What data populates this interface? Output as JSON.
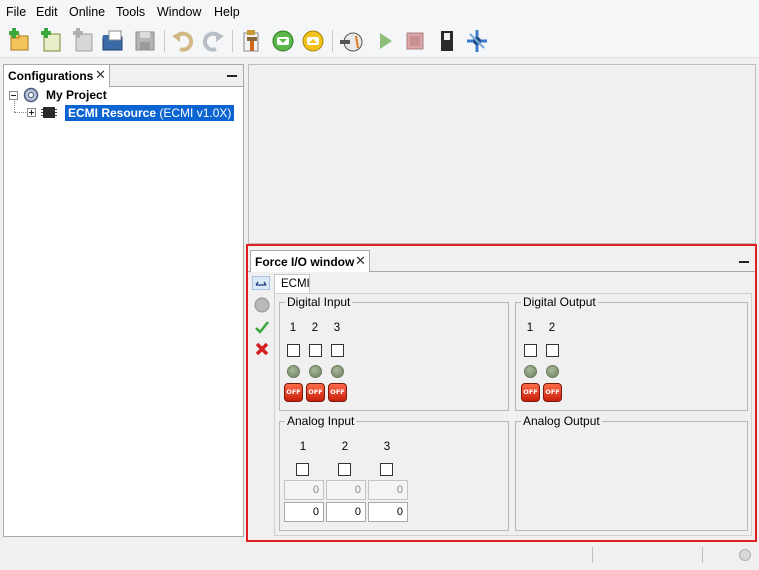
{
  "menu": [
    "File",
    "Edit",
    "Online",
    "Tools",
    "Window",
    "Help"
  ],
  "toolbar": {
    "buttons": [
      "new-project",
      "new-resource",
      "add-item",
      "open",
      "save",
      "undo",
      "redo",
      "build",
      "connect-down",
      "connect-up",
      "online",
      "run",
      "stop",
      "toggle-switch",
      "debug"
    ]
  },
  "left_panel": {
    "tab": "Configurations",
    "tree": {
      "project": "My Project",
      "resource_name": "ECMI Resource",
      "resource_version": "(ECMI v1.0X)"
    }
  },
  "force_io": {
    "tab": "Force I/O window",
    "subtab": "ECMI",
    "digital_input": {
      "title": "Digital Input",
      "channels": [
        "1",
        "2",
        "3"
      ],
      "button_label": "OFF"
    },
    "digital_output": {
      "title": "Digital Output",
      "channels": [
        "1",
        "2"
      ],
      "button_label": "OFF"
    },
    "analog_input": {
      "title": "Analog Input",
      "channels": [
        "1",
        "2",
        "3"
      ],
      "readonly_values": [
        "0",
        "0",
        "0"
      ],
      "values": [
        "0",
        "0",
        "0"
      ]
    },
    "analog_output": {
      "title": "Analog Output"
    }
  },
  "colors": {
    "highlight_border": "#e02020",
    "selection": "#0a64d2"
  }
}
